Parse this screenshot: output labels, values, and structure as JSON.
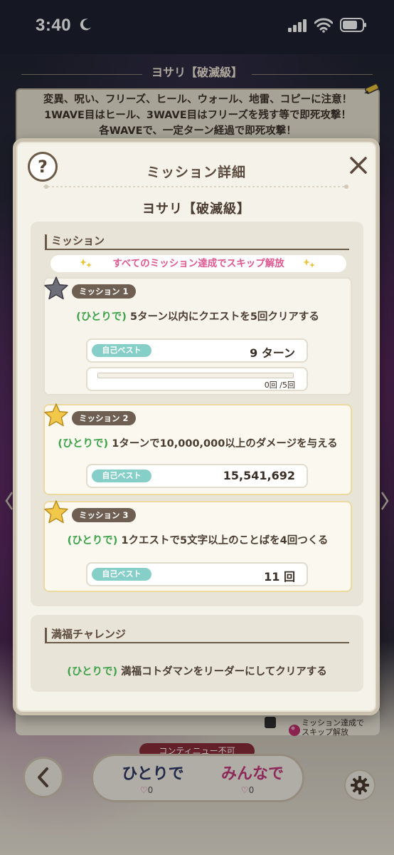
{
  "status": {
    "time": "3:40"
  },
  "background": {
    "header": "ヨサリ【破滅級】",
    "notice_lines": [
      "変異、呪い、フリーズ、ヒール、ウォール、地雷、コピーに注意！",
      "1WAVE目はヒール、3WAVE目はフリーズを残す等で即死攻撃！",
      "各WAVEで、一定ターン経過で即死攻撃！"
    ],
    "skip_note_lines": [
      "ミッション達成で",
      "スキップ解放"
    ],
    "continue_badge": "コンティニュー不可",
    "play_solo": "ひとりで",
    "play_multi": "みんなで",
    "solo_count": "0",
    "multi_count": "0"
  },
  "modal": {
    "title": "ミッション詳細",
    "subtitle": "ヨサリ【破滅級】",
    "mission_section": "ミッション",
    "skip_banner": "すべてのミッション達成でスキップ解放",
    "missions": [
      {
        "label": "ミッション 1",
        "who": "(ひとりで)",
        "text": "5ターン以内にクエストを5回クリアする",
        "best_tag": "自己ベスト",
        "best_value": "9 ターン",
        "progress": 0,
        "progress_text": "0回 /5回",
        "done": false
      },
      {
        "label": "ミッション 2",
        "who": "(ひとりで)",
        "text": "1ターンで10,000,000以上のダメージを与える",
        "best_tag": "自己ベスト",
        "best_value": "15,541,692",
        "done": true
      },
      {
        "label": "ミッション 3",
        "who": "(ひとりで)",
        "text": "1クエストで5文字以上のことばを4回つくる",
        "best_tag": "自己ベスト",
        "best_value": "11 回",
        "done": true
      }
    ],
    "challenge_section": "満福チャレンジ",
    "challenge_who": "(ひとりで)",
    "challenge_text": "満福コトダマンをリーダーにしてクリアする"
  },
  "colors": {
    "accent_green": "#3ea24a",
    "banner_pink": "#e0588f",
    "best_tag": "#86cfc8",
    "star_gold": "#f2c84b",
    "star_gray": "#6e6e78"
  }
}
